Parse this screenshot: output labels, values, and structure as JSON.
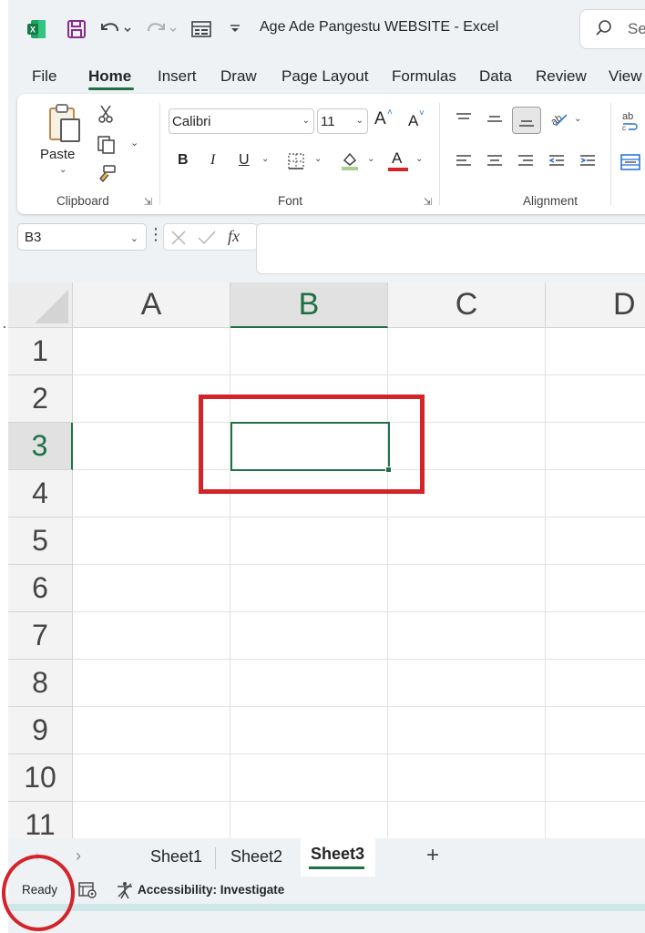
{
  "window": {
    "title": "Age Ade Pangestu WEBSITE  -  Excel",
    "search_placeholder": "Se"
  },
  "menu": {
    "items": [
      "File",
      "Home",
      "Insert",
      "Draw",
      "Page Layout",
      "Formulas",
      "Data",
      "Review",
      "View"
    ],
    "active": "Home"
  },
  "ribbon": {
    "clipboard": {
      "paste_label": "Paste",
      "group_label": "Clipboard"
    },
    "font": {
      "font_name": "Calibri",
      "font_size": "11",
      "bold": "B",
      "italic": "I",
      "underline": "U",
      "grow": "A",
      "shrink": "A",
      "font_color_glyph": "A",
      "group_label": "Font"
    },
    "alignment": {
      "group_label": "Alignment",
      "wrap_glyph": "ab"
    }
  },
  "formula_bar": {
    "name_box": "B3",
    "fx_label": "fx",
    "formula": ""
  },
  "grid": {
    "columns": [
      "A",
      "B",
      "C",
      "D"
    ],
    "rows": [
      "1",
      "2",
      "3",
      "4",
      "5",
      "6",
      "7",
      "8",
      "9",
      "10",
      "11"
    ],
    "selected_cell": "B3",
    "selected_column": "B",
    "selected_row": "3"
  },
  "sheets": {
    "tabs": [
      "Sheet1",
      "Sheet2",
      "Sheet3"
    ],
    "active": "Sheet3",
    "add_label": "+"
  },
  "status": {
    "ready": "Ready",
    "accessibility": "Accessibility: Investigate"
  },
  "colors": {
    "excel_green": "#1e7145",
    "annotation_red": "#d3242a",
    "app_background": "#eef2f5"
  },
  "icons": [
    "excel-logo-icon",
    "save-icon",
    "undo-icon",
    "redo-icon",
    "form-icon",
    "customize-qat-icon",
    "search-icon",
    "cut-icon",
    "copy-icon",
    "format-painter-icon",
    "border-icon",
    "fill-color-icon",
    "align-top-icon",
    "align-middle-icon",
    "align-bottom-icon",
    "orientation-icon",
    "align-left-icon",
    "align-center-icon",
    "align-right-icon",
    "decrease-indent-icon",
    "increase-indent-icon",
    "wrap-text-icon",
    "merge-icon",
    "cancel-icon",
    "enter-icon",
    "page-layout-view-icon",
    "accessibility-icon"
  ]
}
